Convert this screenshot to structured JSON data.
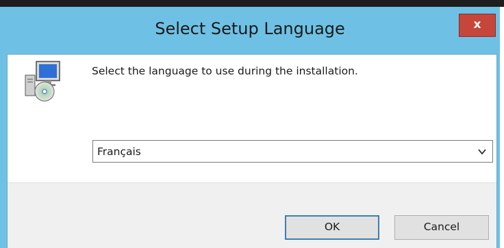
{
  "window": {
    "title": "Select Setup Language",
    "close_label": "x"
  },
  "icons": {
    "setup": "setup-computer-cd-icon",
    "close": "close-icon",
    "dropdown": "chevron-down-icon"
  },
  "dialog": {
    "prompt": "Select the language to use during the installation.",
    "language": {
      "selected": "Français"
    }
  },
  "buttons": {
    "ok": "OK",
    "cancel": "Cancel"
  },
  "colors": {
    "frame": "#6ec1e4",
    "close": "#c7463c",
    "button_bar": "#f0f0f0",
    "default_button_border": "#3c7fb1"
  }
}
